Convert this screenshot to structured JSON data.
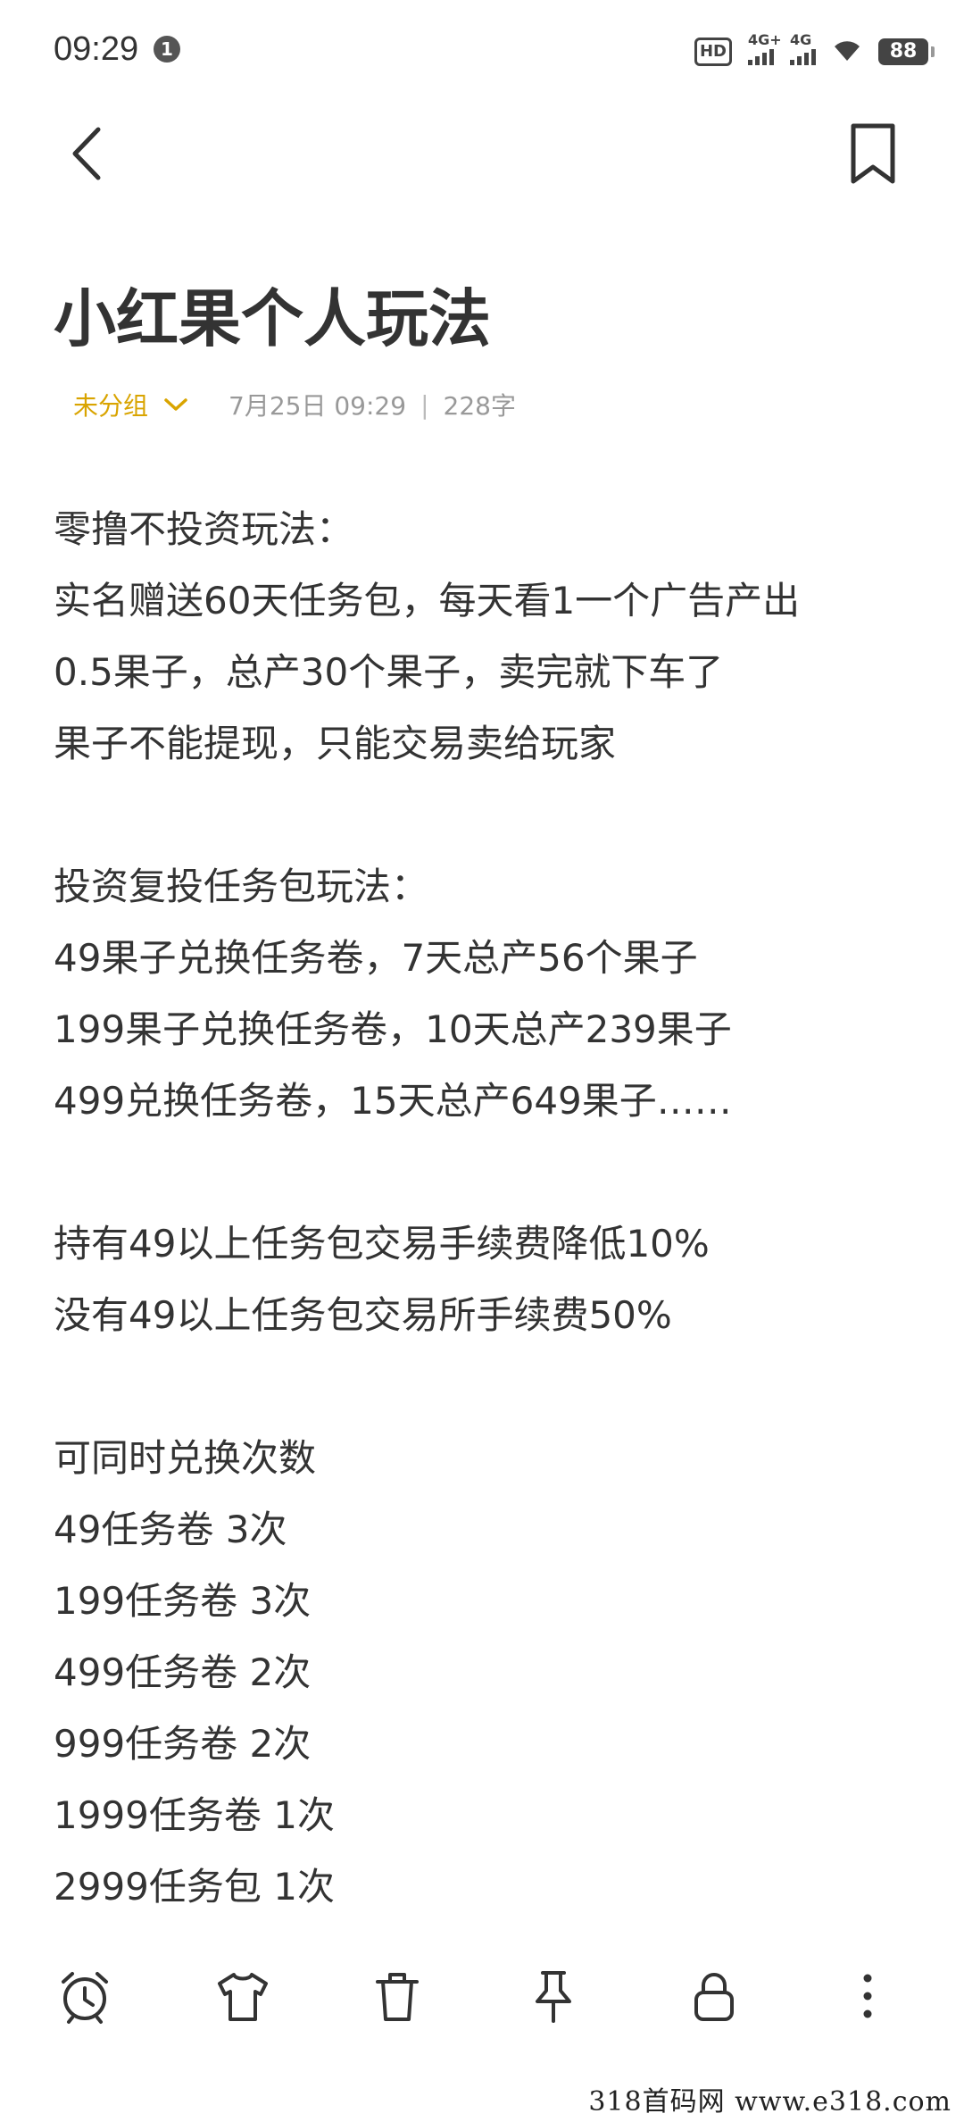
{
  "status_bar": {
    "time": "09:29",
    "notification_count": "1",
    "hd_label": "HD",
    "signal1_label": "4G+",
    "signal2_label": "4G",
    "battery": "88"
  },
  "note": {
    "title": "小红果个人玩法",
    "group": "未分组",
    "date": "7月25日 09:29",
    "separator": "|",
    "word_count": "228字",
    "lines": [
      "零撸不投资玩法：",
      "实名赠送60天任务包，每天看1一个广告产出",
      "0.5果子，总产30个果子，卖完就下车了",
      "果子不能提现，只能交易卖给玩家",
      "",
      "投资复投任务包玩法：",
      "49果子兑换任务卷，7天总产56个果子",
      "199果子兑换任务卷，10天总产239果子",
      "499兑换任务卷，15天总产649果子……",
      "",
      "持有49以上任务包交易手续费降低10%",
      "没有49以上任务包交易所手续费50%",
      "",
      "可同时兑换次数",
      "49任务卷 3次",
      "199任务卷 3次",
      "499任务卷 2次",
      "999任务卷 2次",
      "1999任务卷 1次",
      "2999任务包 1次"
    ]
  },
  "toolbar": {
    "icons": [
      "alarm-clock-icon",
      "tshirt-icon",
      "trash-icon",
      "pin-icon",
      "lock-icon",
      "more-vertical-icon"
    ]
  },
  "watermark": "318首码网  www.e318.com",
  "colors": {
    "accent": "#d9a400",
    "text": "#333333",
    "meta": "#999999"
  }
}
